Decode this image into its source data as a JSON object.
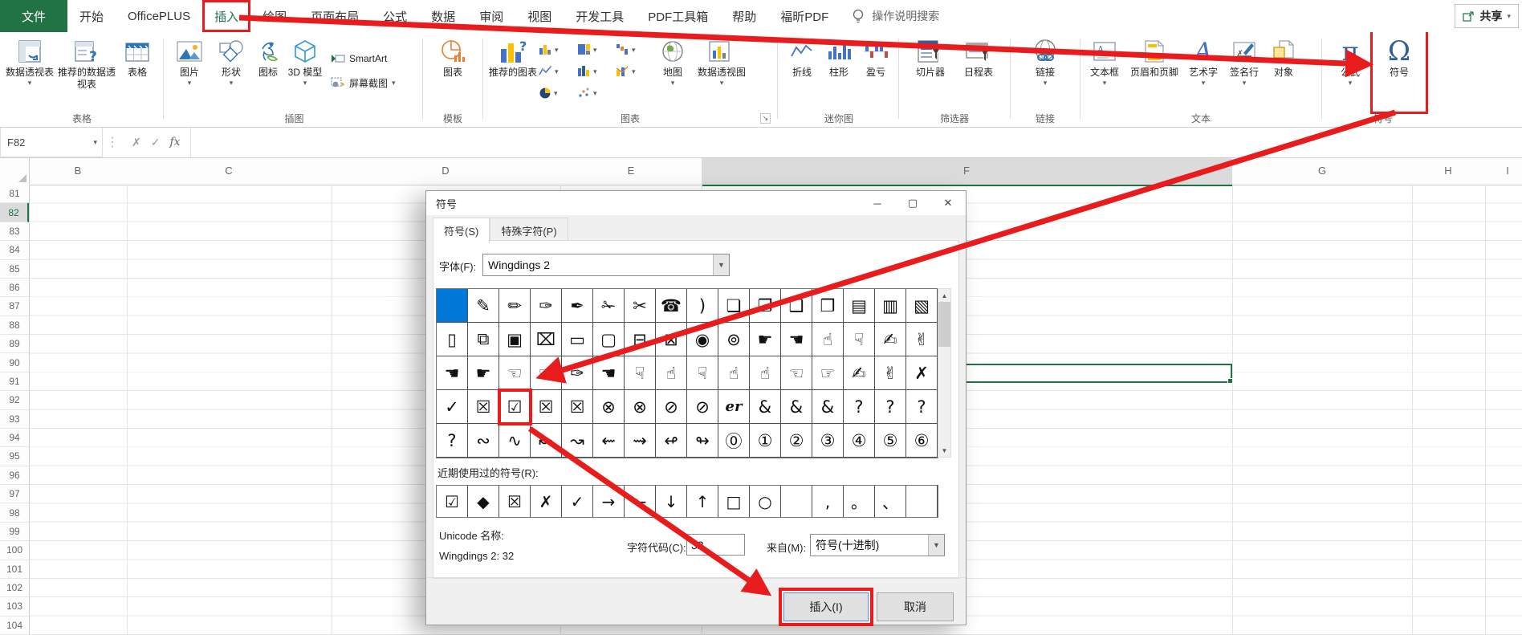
{
  "window": {
    "share_label": "共享",
    "search_label": "操作说明搜索"
  },
  "menu": {
    "file": "文件",
    "tabs": [
      "开始",
      "OfficePLUS",
      "插入",
      "绘图",
      "页面布局",
      "公式",
      "数据",
      "审阅",
      "视图",
      "开发工具",
      "PDF工具箱",
      "帮助",
      "福昕PDF"
    ],
    "active_tab": "插入"
  },
  "ribbon": {
    "tables": {
      "label": "表格",
      "pivot": "数据透视表",
      "recommended_pivot": "推荐的数据透视表",
      "table": "表格"
    },
    "illustrations": {
      "label": "插图",
      "picture": "图片",
      "shapes": "形状",
      "icons": "图标",
      "model3d": "3D 模型",
      "smartart": "SmartArt",
      "screenshot": "屏幕截图"
    },
    "templates": {
      "label": "模板",
      "chart": "图表"
    },
    "charts": {
      "label": "图表",
      "recommended": "推荐的图表",
      "map": "地图",
      "pivotchart": "数据透视图"
    },
    "sparklines": {
      "label": "迷你图",
      "line": "折线",
      "column": "柱形",
      "winloss": "盈亏"
    },
    "filters": {
      "label": "筛选器",
      "slicer": "切片器",
      "timeline": "日程表"
    },
    "links": {
      "label": "链接",
      "link": "链接"
    },
    "text": {
      "label": "文本",
      "textbox": "文本框",
      "headerfooter": "页眉和页脚",
      "wordart": "艺术字",
      "signature": "签名行",
      "object": "对象"
    },
    "symbols": {
      "label": "符号",
      "equation": "公式",
      "symbol": "符号"
    }
  },
  "formula_bar": {
    "name_box": "F82",
    "fx": "fx",
    "cancel": "✗",
    "enter": "✓"
  },
  "sheet": {
    "columns": [
      "B",
      "C",
      "D",
      "E",
      "F",
      "G",
      "H",
      "I"
    ],
    "rows": [
      81,
      82,
      83,
      84,
      85,
      86,
      87,
      88,
      89,
      90,
      91,
      92,
      93,
      94,
      95,
      96,
      97,
      98,
      99,
      100,
      101,
      102,
      103,
      104
    ],
    "active_cell": "F82",
    "active_col": "F",
    "active_row": 82
  },
  "dialog": {
    "title": "符号",
    "tabs": {
      "symbols": "符号(S)",
      "special": "特殊字符(P)"
    },
    "font_label": "字体(F):",
    "font_value": "Wingdings 2",
    "grid": {
      "rows": [
        [
          "",
          "✎",
          "✏",
          "✑",
          "✒",
          "✁",
          "✂",
          "☎",
          ")",
          "❏",
          "❐",
          "❑",
          "❒",
          "▤",
          "▥",
          "▧"
        ],
        [
          "▯",
          "⧉",
          "▣",
          "⌧",
          "▭",
          "▢",
          "⊟",
          "⊠",
          "◉",
          "⊚",
          "☛",
          "☚",
          "☝",
          "☟",
          "✍",
          "✌"
        ],
        [
          "☚",
          "☛",
          "☜",
          "☞",
          "✑",
          "☚",
          "☟",
          "☝",
          "☟",
          "☝",
          "☝",
          "☜",
          "☞",
          "✍",
          "✌",
          "✗"
        ],
        [
          "✓",
          "☒",
          "☑",
          "☒",
          "☒",
          "⊗",
          "⊗",
          "⊘",
          "⊘",
          "er",
          "&",
          "&",
          "&",
          "?",
          "?",
          "?"
        ],
        [
          "?",
          "∾",
          "∿",
          "↜",
          "↝",
          "⇜",
          "⇝",
          "↫",
          "↬",
          "⓪",
          "①",
          "②",
          "③",
          "④",
          "⑤",
          "⑥"
        ]
      ],
      "selected": [
        0,
        0
      ],
      "highlighted": [
        3,
        2
      ]
    },
    "recent_label": "近期使用过的符号(R):",
    "recent": [
      "☑",
      "◆",
      "☒",
      "✗",
      "✓",
      "→",
      "←",
      "↓",
      "↑",
      "□",
      "○",
      "",
      ",",
      "。",
      "、",
      ""
    ],
    "unicode_label": "Unicode 名称:",
    "unicode_value": "Wingdings 2: 32",
    "charcode_label": "字符代码(C):",
    "charcode_value": "32",
    "from_label": "来自(M):",
    "from_value": "符号(十进制)",
    "insert_button": "插入(I)",
    "cancel_button": "取消"
  },
  "colors": {
    "accent_green": "#217346",
    "annotation_red": "#e81c1c",
    "selection_blue": "#0078d7"
  }
}
